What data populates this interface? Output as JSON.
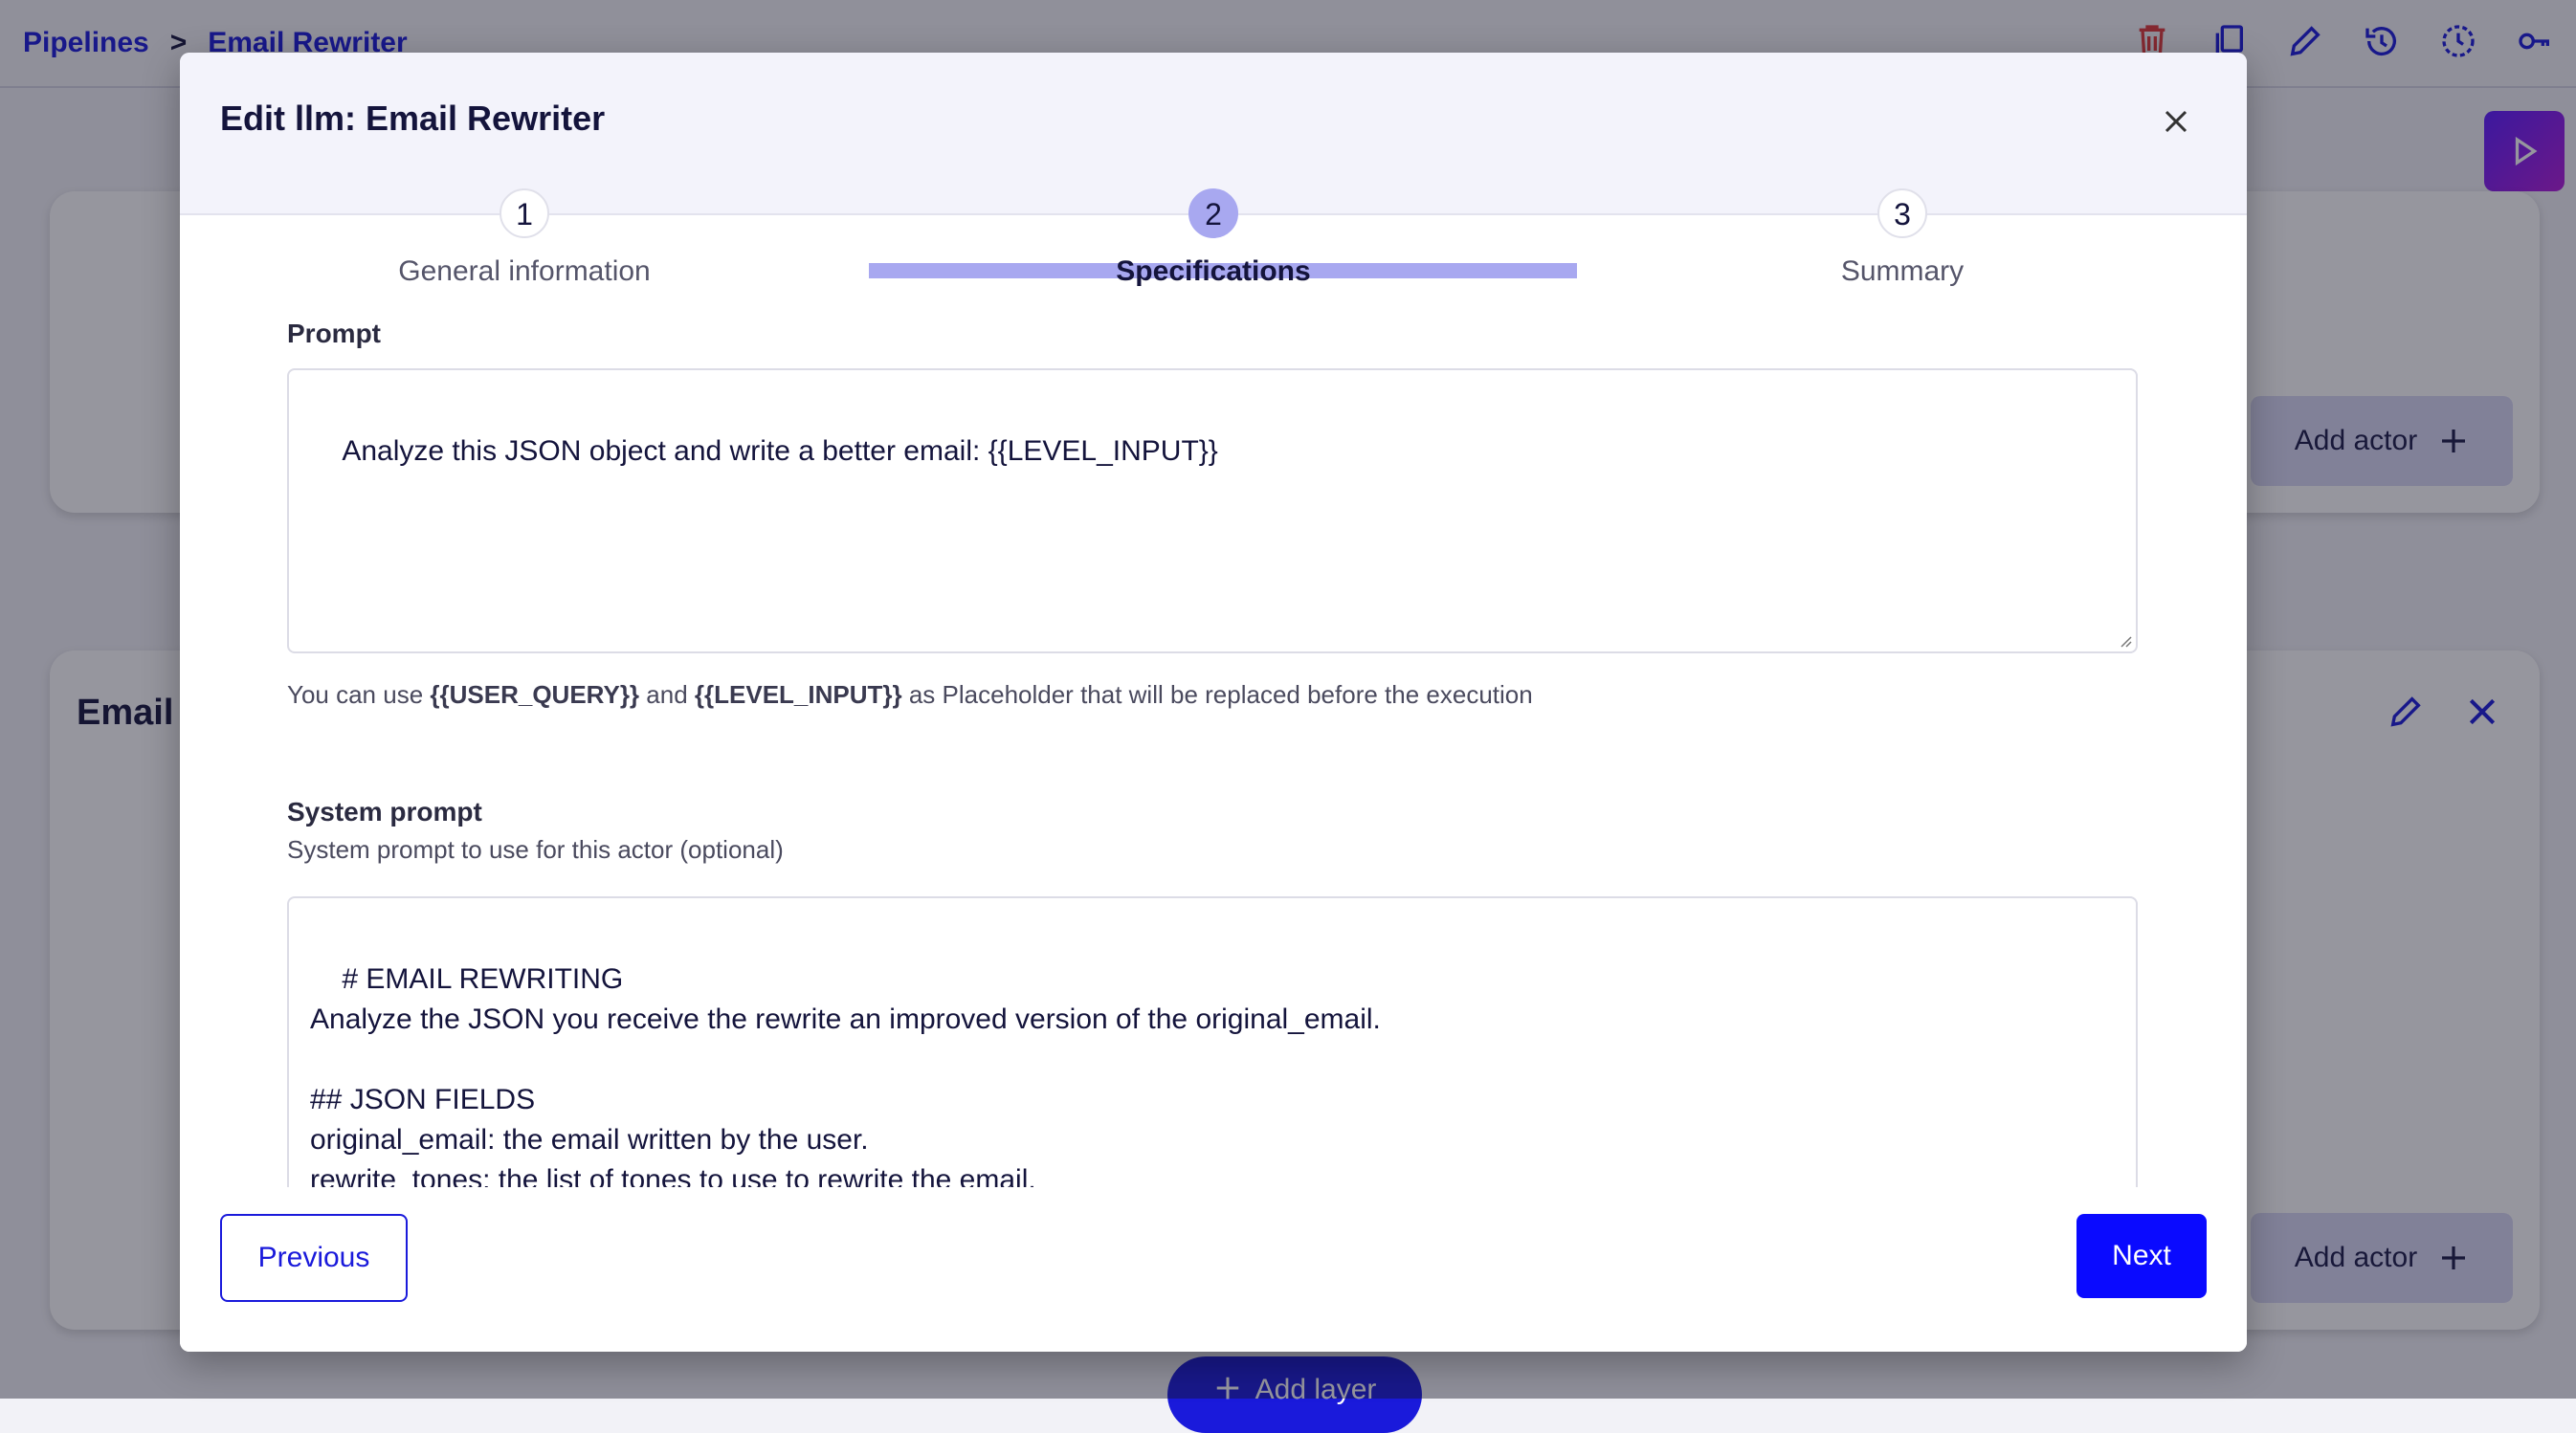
{
  "breadcrumb": {
    "root": "Pipelines",
    "separator": ">",
    "current": "Email Rewriter"
  },
  "top_icons": [
    "trash-icon",
    "copy-icon",
    "pencil-icon",
    "history-icon",
    "schedule-icon",
    "key-icon"
  ],
  "background": {
    "layer_title": "Email",
    "add_actor_label": "Add actor",
    "add_layer_label": "Add layer"
  },
  "modal": {
    "title": "Edit llm: Email Rewriter",
    "steps": [
      {
        "number": "1",
        "label": "General information",
        "active": false
      },
      {
        "number": "2",
        "label": "Specifications",
        "active": true
      },
      {
        "number": "3",
        "label": "Summary",
        "active": false
      }
    ],
    "prompt": {
      "label": "Prompt",
      "value": "Analyze this JSON object and write a better email: {{LEVEL_INPUT}}",
      "hint_prefix": "You can use ",
      "hint_var1": "{{USER_QUERY}}",
      "hint_and": " and ",
      "hint_var2": "{{LEVEL_INPUT}}",
      "hint_suffix": " as Placeholder that will be replaced before the execution"
    },
    "system_prompt": {
      "label": "System prompt",
      "sublabel": "System prompt to use for this actor (optional)",
      "value": "# EMAIL REWRITING\nAnalyze the JSON you receive the rewrite an improved version of the original_email.\n\n## JSON FIELDS\noriginal_email: the email written by the user.\nrewrite_tones: the list of tones to use to rewrite the email.\nproblems: a list of problems found in the original email, that you need to fix."
    },
    "previous_label": "Previous",
    "next_label": "Next"
  },
  "colors": {
    "accent": "#0a0aff",
    "link": "#1a1adb",
    "step_active": "#a8a8f0",
    "danger": "#e03a3a"
  }
}
